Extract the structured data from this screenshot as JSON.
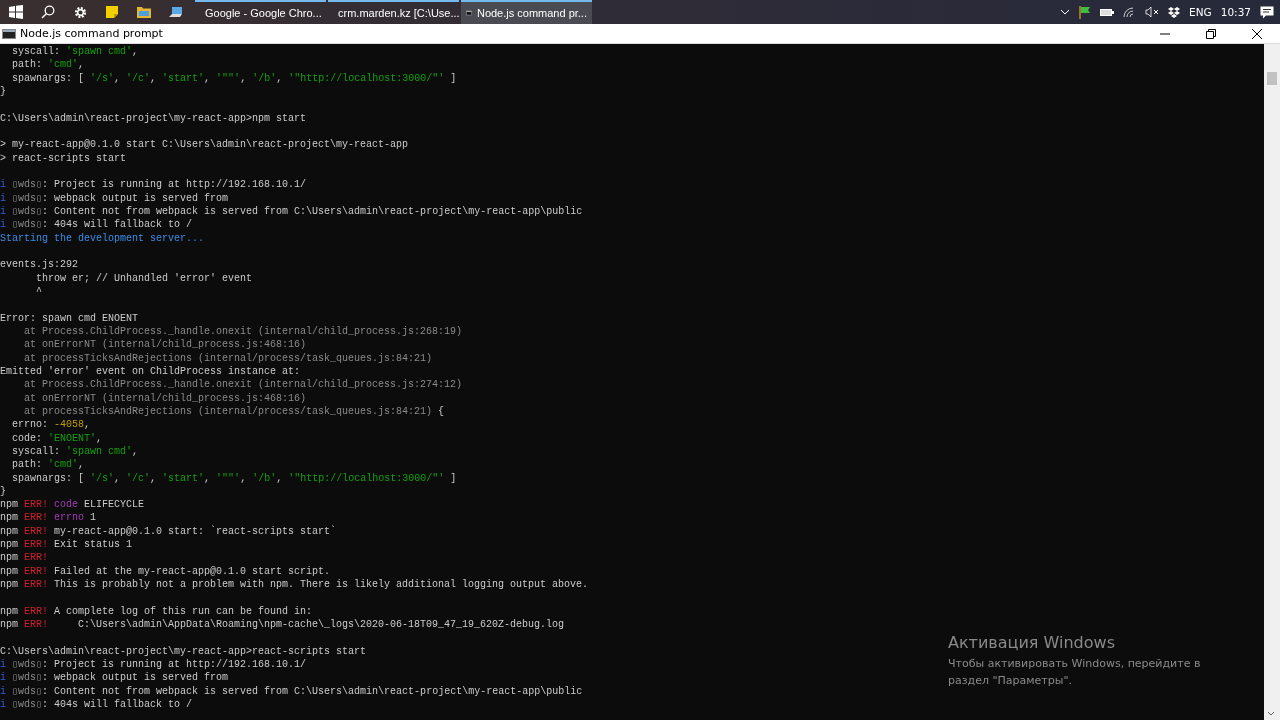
{
  "taskbar": {
    "apps": [
      {
        "title": "Google - Google Chro...",
        "selected": false
      },
      {
        "title": "crm.marden.kz [C:\\Use...",
        "selected": false
      },
      {
        "title": "Node.js command pr...",
        "selected": true
      }
    ],
    "language": "ENG",
    "time": "10:37"
  },
  "window": {
    "title": "Node.js command prompt"
  },
  "terminal": {
    "lines": [
      {
        "kind": "text",
        "segments": [
          {
            "text": "  syscall: ",
            "kind": "plain"
          },
          {
            "text": "'spawn cmd'",
            "kind": "string"
          },
          {
            "text": ",",
            "kind": "plain"
          }
        ]
      },
      {
        "kind": "text",
        "segments": [
          {
            "text": "  path: ",
            "kind": "plain"
          },
          {
            "text": "'cmd'",
            "kind": "string"
          },
          {
            "text": ",",
            "kind": "plain"
          }
        ]
      },
      {
        "kind": "text",
        "segments": [
          {
            "text": "  spawnargs: [ ",
            "kind": "plain"
          },
          {
            "text": "'/s'",
            "kind": "string"
          },
          {
            "text": ", ",
            "kind": "plain"
          },
          {
            "text": "'/c'",
            "kind": "string"
          },
          {
            "text": ", ",
            "kind": "plain"
          },
          {
            "text": "'start'",
            "kind": "string"
          },
          {
            "text": ", ",
            "kind": "plain"
          },
          {
            "text": "'\"\"'",
            "kind": "string"
          },
          {
            "text": ", ",
            "kind": "plain"
          },
          {
            "text": "'/b'",
            "kind": "string"
          },
          {
            "text": ", ",
            "kind": "plain"
          },
          {
            "text": "'\"http://localhost:3000/\"'",
            "kind": "string"
          },
          {
            "text": " ]",
            "kind": "plain"
          }
        ]
      },
      {
        "kind": "text",
        "segments": [
          {
            "text": "}",
            "kind": "plain"
          }
        ]
      },
      {
        "kind": "blank"
      },
      {
        "kind": "text",
        "segments": [
          {
            "text": "C:\\Users\\admin\\react-project\\my-react-app>npm start",
            "kind": "plain"
          }
        ]
      },
      {
        "kind": "blank"
      },
      {
        "kind": "text",
        "segments": [
          {
            "text": "> my-react-app@0.1.0 start C:\\Users\\admin\\react-project\\my-react-app",
            "kind": "plain"
          }
        ]
      },
      {
        "kind": "text",
        "segments": [
          {
            "text": "> react-scripts start",
            "kind": "plain"
          }
        ]
      },
      {
        "kind": "blank"
      },
      {
        "kind": "text",
        "segments": [
          {
            "text": "i ",
            "kind": "info"
          },
          {
            "text": "▯wds▯",
            "kind": "dim"
          },
          {
            "text": ": Project is running at http://192.168.10.1/",
            "kind": "plain"
          }
        ]
      },
      {
        "kind": "text",
        "segments": [
          {
            "text": "i ",
            "kind": "info"
          },
          {
            "text": "▯wds▯",
            "kind": "dim"
          },
          {
            "text": ": webpack output is served from",
            "kind": "plain"
          }
        ]
      },
      {
        "kind": "text",
        "segments": [
          {
            "text": "i ",
            "kind": "info"
          },
          {
            "text": "▯wds▯",
            "kind": "dim"
          },
          {
            "text": ": Content not from webpack is served from C:\\Users\\admin\\react-project\\my-react-app\\public",
            "kind": "plain"
          }
        ]
      },
      {
        "kind": "text",
        "segments": [
          {
            "text": "i ",
            "kind": "info"
          },
          {
            "text": "▯wds▯",
            "kind": "dim"
          },
          {
            "text": ": 404s will fallback to /",
            "kind": "plain"
          }
        ]
      },
      {
        "kind": "text",
        "segments": [
          {
            "text": "Starting the development server...",
            "kind": "notice"
          }
        ]
      },
      {
        "kind": "blank"
      },
      {
        "kind": "text",
        "segments": [
          {
            "text": "events.js:292",
            "kind": "plain"
          }
        ]
      },
      {
        "kind": "text",
        "segments": [
          {
            "text": "      throw er; // Unhandled 'error' event",
            "kind": "plain"
          }
        ]
      },
      {
        "kind": "text",
        "segments": [
          {
            "text": "      ^",
            "kind": "plain"
          }
        ]
      },
      {
        "kind": "blank"
      },
      {
        "kind": "text",
        "segments": [
          {
            "text": "Error: spawn cmd ENOENT",
            "kind": "plain"
          }
        ]
      },
      {
        "kind": "text",
        "segments": [
          {
            "text": "    at Process.ChildProcess._handle.onexit (internal/child_process.js:268:19)",
            "kind": "dim"
          }
        ]
      },
      {
        "kind": "text",
        "segments": [
          {
            "text": "    at onErrorNT (internal/child_process.js:468:16)",
            "kind": "dim"
          }
        ]
      },
      {
        "kind": "text",
        "segments": [
          {
            "text": "    at processTicksAndRejections (internal/process/task_queues.js:84:21)",
            "kind": "dim"
          }
        ]
      },
      {
        "kind": "text",
        "segments": [
          {
            "text": "Emitted 'error' event on ChildProcess instance at:",
            "kind": "plain"
          }
        ]
      },
      {
        "kind": "text",
        "segments": [
          {
            "text": "    at Process.ChildProcess._handle.onexit (internal/child_process.js:274:12)",
            "kind": "dim"
          }
        ]
      },
      {
        "kind": "text",
        "segments": [
          {
            "text": "    at onErrorNT (internal/child_process.js:468:16)",
            "kind": "dim"
          }
        ]
      },
      {
        "kind": "text",
        "segments": [
          {
            "text": "    at processTicksAndRejections (internal/process/task_queues.js:84:21)",
            "kind": "dim"
          },
          {
            "text": " {",
            "kind": "plain"
          }
        ]
      },
      {
        "kind": "text",
        "segments": [
          {
            "text": "  errno: ",
            "kind": "plain"
          },
          {
            "text": "-4058",
            "kind": "number"
          },
          {
            "text": ",",
            "kind": "plain"
          }
        ]
      },
      {
        "kind": "text",
        "segments": [
          {
            "text": "  code: ",
            "kind": "plain"
          },
          {
            "text": "'ENOENT'",
            "kind": "string"
          },
          {
            "text": ",",
            "kind": "plain"
          }
        ]
      },
      {
        "kind": "text",
        "segments": [
          {
            "text": "  syscall: ",
            "kind": "plain"
          },
          {
            "text": "'spawn cmd'",
            "kind": "string"
          },
          {
            "text": ",",
            "kind": "plain"
          }
        ]
      },
      {
        "kind": "text",
        "segments": [
          {
            "text": "  path: ",
            "kind": "plain"
          },
          {
            "text": "'cmd'",
            "kind": "string"
          },
          {
            "text": ",",
            "kind": "plain"
          }
        ]
      },
      {
        "kind": "text",
        "segments": [
          {
            "text": "  spawnargs: [ ",
            "kind": "plain"
          },
          {
            "text": "'/s'",
            "kind": "string"
          },
          {
            "text": ", ",
            "kind": "plain"
          },
          {
            "text": "'/c'",
            "kind": "string"
          },
          {
            "text": ", ",
            "kind": "plain"
          },
          {
            "text": "'start'",
            "kind": "string"
          },
          {
            "text": ", ",
            "kind": "plain"
          },
          {
            "text": "'\"\"'",
            "kind": "string"
          },
          {
            "text": ", ",
            "kind": "plain"
          },
          {
            "text": "'/b'",
            "kind": "string"
          },
          {
            "text": ", ",
            "kind": "plain"
          },
          {
            "text": "'\"http://localhost:3000/\"'",
            "kind": "string"
          },
          {
            "text": " ]",
            "kind": "plain"
          }
        ]
      },
      {
        "kind": "text",
        "segments": [
          {
            "text": "}",
            "kind": "plain"
          }
        ]
      },
      {
        "kind": "text",
        "segments": [
          {
            "text": "npm ",
            "kind": "plain"
          },
          {
            "text": "ERR! ",
            "kind": "error"
          },
          {
            "text": "code",
            "kind": "keyword"
          },
          {
            "text": " ELIFECYCLE",
            "kind": "plain"
          }
        ]
      },
      {
        "kind": "text",
        "segments": [
          {
            "text": "npm ",
            "kind": "plain"
          },
          {
            "text": "ERR! ",
            "kind": "error"
          },
          {
            "text": "errno",
            "kind": "keyword"
          },
          {
            "text": " 1",
            "kind": "plain"
          }
        ]
      },
      {
        "kind": "text",
        "segments": [
          {
            "text": "npm ",
            "kind": "plain"
          },
          {
            "text": "ERR!",
            "kind": "error"
          },
          {
            "text": " my-react-app@0.1.0 start: `react-scripts start`",
            "kind": "plain"
          }
        ]
      },
      {
        "kind": "text",
        "segments": [
          {
            "text": "npm ",
            "kind": "plain"
          },
          {
            "text": "ERR!",
            "kind": "error"
          },
          {
            "text": " Exit status 1",
            "kind": "plain"
          }
        ]
      },
      {
        "kind": "text",
        "segments": [
          {
            "text": "npm ",
            "kind": "plain"
          },
          {
            "text": "ERR!",
            "kind": "error"
          }
        ]
      },
      {
        "kind": "text",
        "segments": [
          {
            "text": "npm ",
            "kind": "plain"
          },
          {
            "text": "ERR!",
            "kind": "error"
          },
          {
            "text": " Failed at the my-react-app@0.1.0 start script.",
            "kind": "plain"
          }
        ]
      },
      {
        "kind": "text",
        "segments": [
          {
            "text": "npm ",
            "kind": "plain"
          },
          {
            "text": "ERR!",
            "kind": "error"
          },
          {
            "text": " This is probably not a problem with npm. There is likely additional logging output above.",
            "kind": "plain"
          }
        ]
      },
      {
        "kind": "blank"
      },
      {
        "kind": "text",
        "segments": [
          {
            "text": "npm ",
            "kind": "plain"
          },
          {
            "text": "ERR!",
            "kind": "error"
          },
          {
            "text": " A complete log of this run can be found in:",
            "kind": "plain"
          }
        ]
      },
      {
        "kind": "text",
        "segments": [
          {
            "text": "npm ",
            "kind": "plain"
          },
          {
            "text": "ERR!",
            "kind": "error"
          },
          {
            "text": "     C:\\Users\\admin\\AppData\\Roaming\\npm-cache\\_logs\\2020-06-18T09_47_19_620Z-debug.log",
            "kind": "plain"
          }
        ]
      },
      {
        "kind": "blank"
      },
      {
        "kind": "text",
        "segments": [
          {
            "text": "C:\\Users\\admin\\react-project\\my-react-app>react-scripts start",
            "kind": "plain"
          }
        ]
      },
      {
        "kind": "text",
        "segments": [
          {
            "text": "i ",
            "kind": "info"
          },
          {
            "text": "▯wds▯",
            "kind": "dim"
          },
          {
            "text": ": Project is running at http://192.168.10.1/",
            "kind": "plain"
          }
        ]
      },
      {
        "kind": "text",
        "segments": [
          {
            "text": "i ",
            "kind": "info"
          },
          {
            "text": "▯wds▯",
            "kind": "dim"
          },
          {
            "text": ": webpack output is served from",
            "kind": "plain"
          }
        ]
      },
      {
        "kind": "text",
        "segments": [
          {
            "text": "i ",
            "kind": "info"
          },
          {
            "text": "▯wds▯",
            "kind": "dim"
          },
          {
            "text": ": Content not from webpack is served from C:\\Users\\admin\\react-project\\my-react-app\\public",
            "kind": "plain"
          }
        ]
      },
      {
        "kind": "text",
        "segments": [
          {
            "text": "i ",
            "kind": "info"
          },
          {
            "text": "▯wds▯",
            "kind": "dim"
          },
          {
            "text": ": 404s will fallback to /",
            "kind": "plain"
          }
        ]
      }
    ]
  },
  "activation_notice": {
    "title": "Активация Windows",
    "text": "Чтобы активировать Windows, перейдите в раздел \"Параметры\"."
  }
}
